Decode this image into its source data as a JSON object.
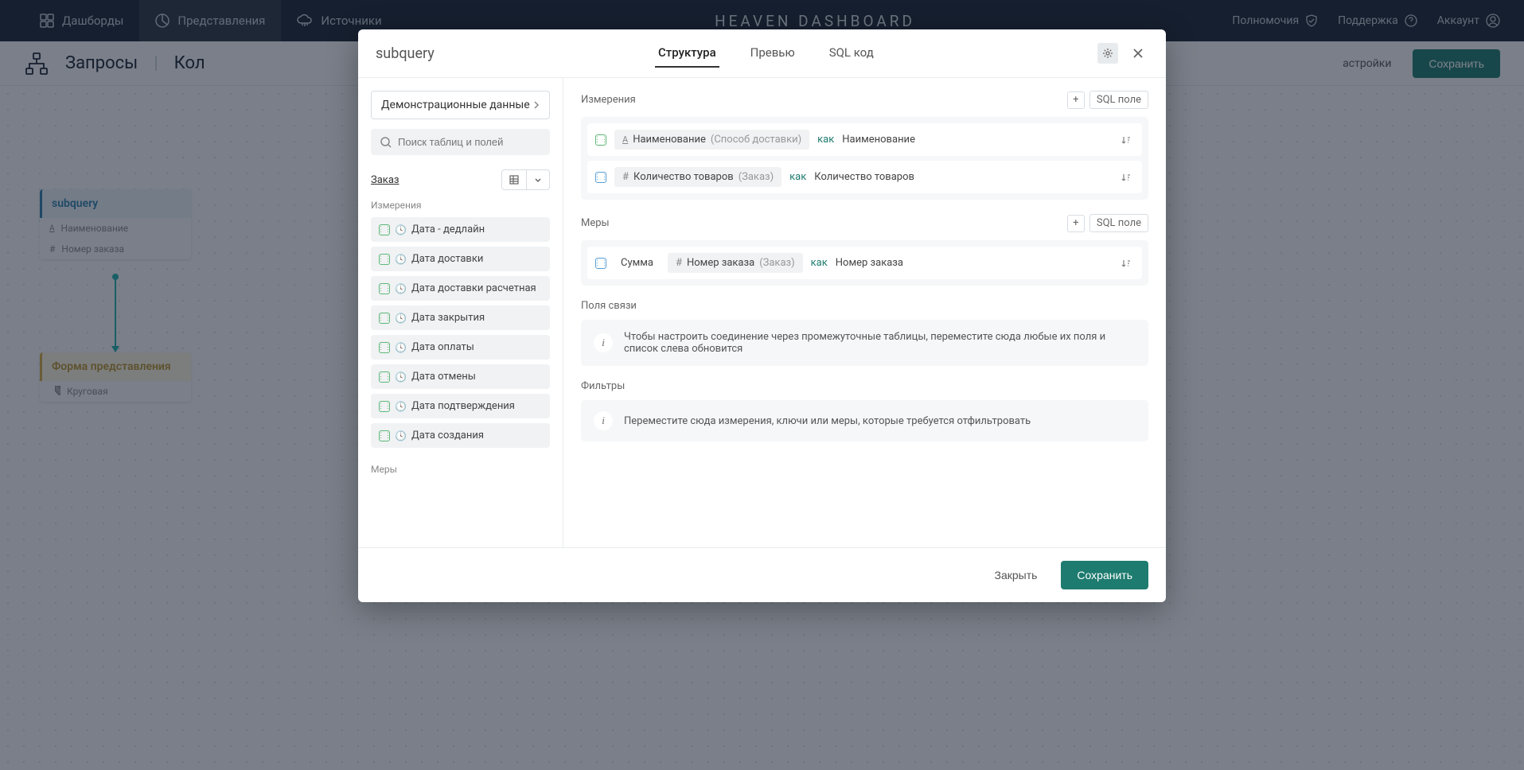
{
  "topnav": {
    "items": [
      {
        "label": "Дашборды"
      },
      {
        "label": "Представления"
      },
      {
        "label": "Источники"
      }
    ],
    "brand": "HEAVEN DASHBOARD",
    "right": [
      {
        "label": "Полномочия"
      },
      {
        "label": "Поддержка"
      },
      {
        "label": "Аккаунт"
      }
    ]
  },
  "subheader": {
    "title": "Запросы",
    "crumb": "Кол",
    "settings": "астройки",
    "save": "Сохранить"
  },
  "canvas": {
    "subquery": {
      "title": "subquery",
      "fields": [
        {
          "label": "Наименование"
        },
        {
          "label": "Номер заказа"
        }
      ]
    },
    "form": {
      "title": "Форма представления",
      "type": "Круговая"
    }
  },
  "modal": {
    "title": "subquery",
    "tabs": [
      {
        "label": "Структура"
      },
      {
        "label": "Превью"
      },
      {
        "label": "SQL код"
      }
    ],
    "left": {
      "source": "Демонстрационные данные",
      "search_placeholder": "Поиск таблиц и полей",
      "table": "Заказ",
      "dimensions_label": "Измерения",
      "dimension_fields": [
        "Дата - дедлайн",
        "Дата доставки",
        "Дата доставки расчетная",
        "Дата закрытия",
        "Дата оплаты",
        "Дата отмены",
        "Дата подтверждения",
        "Дата создания"
      ],
      "measures_label": "Меры"
    },
    "right": {
      "dimensions_title": "Измерения",
      "sql_field": "SQL поле",
      "dim_rows": [
        {
          "field": "Наименование",
          "hint": "(Способ доставки)",
          "as": "как",
          "alias": "Наименование"
        },
        {
          "field": "Количество товаров",
          "hint": "(Заказ)",
          "as": "как",
          "alias": "Количество товаров"
        }
      ],
      "measures_title": "Меры",
      "measure_rows": [
        {
          "agg": "Сумма",
          "field": "Номер заказа",
          "hint": "(Заказ)",
          "as": "как",
          "alias": "Номер заказа"
        }
      ],
      "links_title": "Поля связи",
      "links_info": "Чтобы настроить соединение через промежуточные таблицы, переместите сюда любые их поля и список слева обновится",
      "filters_title": "Фильтры",
      "filters_info": "Переместите сюда измерения, ключи или меры, которые требуется отфильтровать"
    },
    "footer": {
      "close": "Закрыть",
      "save": "Сохранить"
    }
  }
}
